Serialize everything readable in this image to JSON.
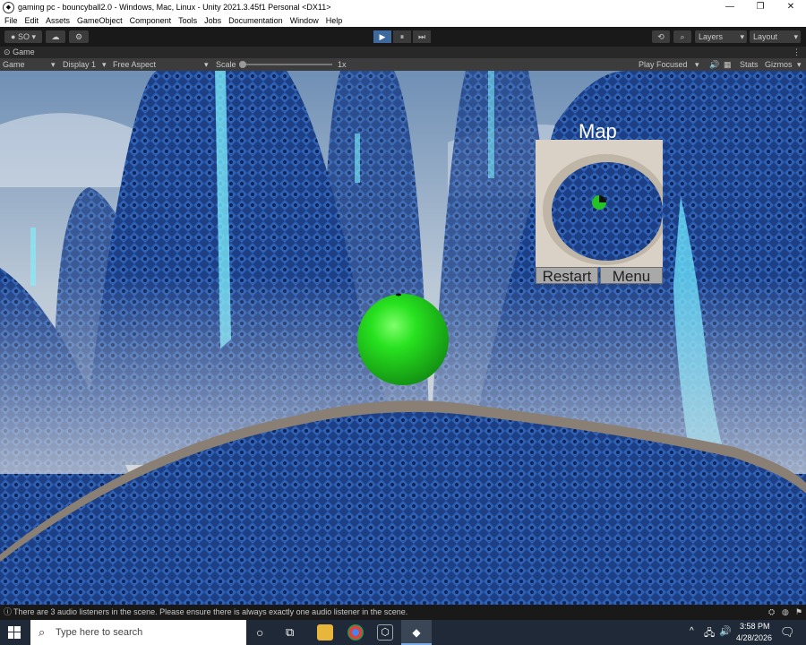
{
  "window": {
    "title": "gaming pc - bouncyball2.0 - Windows, Mac, Linux - Unity 2021.3.45f1 Personal <DX11>",
    "app_icon": "unity-icon",
    "minimize": "—",
    "maximize": "❐",
    "close": "✕"
  },
  "menu": [
    "File",
    "Edit",
    "Assets",
    "GameObject",
    "Component",
    "Tools",
    "Jobs",
    "Documentation",
    "Window",
    "Help"
  ],
  "toolbar": {
    "account": "SO",
    "layers": "Layers",
    "layout": "Layout",
    "play_glyph": "▶",
    "pause_glyph": "⏸",
    "step_glyph": "⏭",
    "accent": "#3c6a9e"
  },
  "game_tab": {
    "tab_label": "Game",
    "view_select": "Game",
    "display_select": "Display 1",
    "aspect_select": "Free Aspect",
    "scale_label": "Scale",
    "scale_value": "1x",
    "play_focused": "Play Focused",
    "stats": "Stats",
    "gizmos": "Gizmos"
  },
  "hud": {
    "map_title": "Map",
    "restart_button": "Restart",
    "menu_button": "Menu"
  },
  "status": {
    "message": "There are 3 audio listeners in the scene. Please ensure there is always exactly one audio listener in the scene."
  },
  "taskbar": {
    "search_placeholder": "Type here to search",
    "time": "3:58 PM",
    "date": "4/28/2026"
  }
}
